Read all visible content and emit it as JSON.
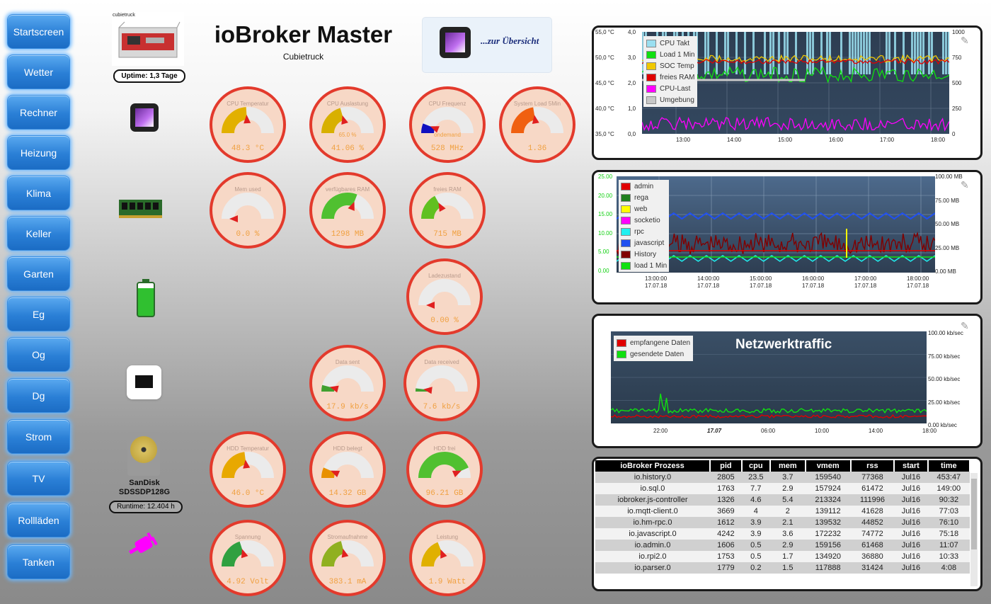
{
  "nav": [
    "Startscreen",
    "Wetter",
    "Rechner",
    "Heizung",
    "Klima",
    "Keller",
    "Garten",
    "Eg",
    "Og",
    "Dg",
    "Strom",
    "TV",
    "Rollläden",
    "Tanken"
  ],
  "header": {
    "title": "ioBroker Master",
    "subtitle": "Cubietruck",
    "overview_link": "...zur Übersicht"
  },
  "device": {
    "caption": "cubietruck",
    "uptime": "Uptime: 1,3 Tage"
  },
  "disk": {
    "name_line1": "SanDisk",
    "name_line2": "SDSSDP128G",
    "runtime": "Runtime: 12.404 h"
  },
  "gauges": [
    {
      "title": "CPU Temperatur",
      "value": "48.3 °C",
      "fill": 0.48,
      "color": "#e2b000"
    },
    {
      "title": "CPU Auslastung",
      "value": "41.06 %",
      "inner": "65.0 %",
      "fill": 0.41,
      "color": "#d8b000"
    },
    {
      "title": "CPU Frequenz",
      "value": "528 MHz",
      "inner": "ondemand",
      "fill": 0.12,
      "color": "#1010c0"
    },
    {
      "title": "System Load 5Min",
      "value": "1.36",
      "fill": 0.45,
      "color": "#f06010"
    },
    {
      "title": "Mem used",
      "value": "0.0 %",
      "fill": 0.0,
      "color": "#e0e0e0"
    },
    {
      "title": "verfügbares RAM",
      "value": "1298 MB",
      "fill": 0.62,
      "color": "#50c030"
    },
    {
      "title": "freies RAM",
      "value": "715 MB",
      "fill": 0.34,
      "color": "#60c020"
    },
    {
      "title": "Ladezustand",
      "value": "0.00 %",
      "fill": 0.0,
      "color": "#e0e0e0"
    },
    {
      "title": "Data sent",
      "value": "17.9 kb/s",
      "fill": 0.08,
      "color": "#40a030"
    },
    {
      "title": "Data received",
      "value": "7.6 kb/s",
      "fill": 0.04,
      "color": "#40a030"
    },
    {
      "title": "HDD Temperatur",
      "value": "46.0 °C",
      "fill": 0.46,
      "color": "#e8a800"
    },
    {
      "title": "HDD belegt",
      "value": "14.32 GB",
      "fill": 0.13,
      "color": "#e89000"
    },
    {
      "title": "HDD frei",
      "value": "96.21 GB",
      "fill": 0.87,
      "color": "#50c030"
    },
    {
      "title": "Spannung",
      "value": "4.92 Volt",
      "fill": 0.4,
      "color": "#30a040"
    },
    {
      "title": "Stromaufnahme",
      "value": "383.1 mA",
      "fill": 0.42,
      "color": "#90b020"
    },
    {
      "title": "Leistung",
      "value": "1.9 Watt",
      "fill": 0.38,
      "color": "#e0b000"
    }
  ],
  "chart_data": [
    {
      "type": "line",
      "title": "",
      "series": [
        {
          "name": "CPU Takt",
          "color": "#9adff0"
        },
        {
          "name": "Load 1 Min",
          "color": "#10e010"
        },
        {
          "name": "SOC Temp",
          "color": "#f0c800"
        },
        {
          "name": "freies RAM",
          "color": "#e00000"
        },
        {
          "name": "CPU-Last",
          "color": "#ff00ff"
        },
        {
          "name": "Umgebung",
          "color": "#c8c8c8"
        }
      ],
      "y_left_labels": [
        "55,0 °C",
        "50,0 °C",
        "45,0 °C",
        "40,0 °C",
        "35,0 °C"
      ],
      "y_mid_labels": [
        "4,0",
        "3,0",
        "2,0",
        "1,0",
        "0,0"
      ],
      "y_right_labels": [
        "1000",
        "750",
        "500",
        "250",
        "0"
      ],
      "x_labels": [
        "13:00",
        "14:00",
        "15:00",
        "16:00",
        "17:00",
        "18:00"
      ]
    },
    {
      "type": "line",
      "title": "",
      "series": [
        {
          "name": "admin",
          "color": "#e00000"
        },
        {
          "name": "rega",
          "color": "#208020"
        },
        {
          "name": "web",
          "color": "#ffff00"
        },
        {
          "name": "socketio",
          "color": "#ff00ff"
        },
        {
          "name": "rpc",
          "color": "#20f0f0"
        },
        {
          "name": "javascript",
          "color": "#2050f0"
        },
        {
          "name": "History",
          "color": "#800000"
        },
        {
          "name": "load 1 Min",
          "color": "#10e010"
        }
      ],
      "y_left_labels": [
        "25.00",
        "20.00",
        "15.00",
        "10.00",
        "5.00",
        "0.00"
      ],
      "y_right_labels": [
        "100.00 MB",
        "75.00 MB",
        "50.00 MB",
        "25.00 MB",
        "0.00 MB"
      ],
      "x_labels": [
        [
          "13:00:00",
          "17.07.18"
        ],
        [
          "14:00:00",
          "17.07.18"
        ],
        [
          "15:00:00",
          "17.07.18"
        ],
        [
          "16:00:00",
          "17.07.18"
        ],
        [
          "17:00:00",
          "17.07.18"
        ],
        [
          "18:00:00",
          "17.07.18"
        ]
      ]
    },
    {
      "type": "line",
      "title": "Netzwerktraffic",
      "series": [
        {
          "name": "empfangene Daten",
          "color": "#e00000"
        },
        {
          "name": "gesendete Daten",
          "color": "#10e010"
        }
      ],
      "y_right_labels": [
        "100.00 kb/sec",
        "75.00 kb/sec",
        "50.00 kb/sec",
        "25.00 kb/sec",
        "0.00 kb/sec"
      ],
      "x_labels": [
        "22:00",
        "17.07",
        "06:00",
        "10:00",
        "14:00",
        "18:00"
      ]
    }
  ],
  "process_table": {
    "headers": [
      "ioBroker Prozess",
      "pid",
      "cpu",
      "mem",
      "vmem",
      "rss",
      "start",
      "time"
    ],
    "rows": [
      [
        "io.history.0",
        "2805",
        "23.5",
        "3.7",
        "159540",
        "77368",
        "Jul16",
        "453:47"
      ],
      [
        "io.sql.0",
        "1763",
        "7.7",
        "2.9",
        "157924",
        "61472",
        "Jul16",
        "149:00"
      ],
      [
        "iobroker.js-controller",
        "1326",
        "4.6",
        "5.4",
        "213324",
        "111996",
        "Jul16",
        "90:32"
      ],
      [
        "io.mqtt-client.0",
        "3669",
        "4",
        "2",
        "139112",
        "41628",
        "Jul16",
        "77:03"
      ],
      [
        "io.hm-rpc.0",
        "1612",
        "3.9",
        "2.1",
        "139532",
        "44852",
        "Jul16",
        "76:10"
      ],
      [
        "io.javascript.0",
        "4242",
        "3.9",
        "3.6",
        "172232",
        "74772",
        "Jul16",
        "75:18"
      ],
      [
        "io.admin.0",
        "1606",
        "0.5",
        "2.9",
        "159156",
        "61468",
        "Jul16",
        "11:07"
      ],
      [
        "io.rpi2.0",
        "1753",
        "0.5",
        "1.7",
        "134920",
        "36880",
        "Jul16",
        "10:33"
      ],
      [
        "io.parser.0",
        "1779",
        "0.2",
        "1.5",
        "117888",
        "31424",
        "Jul16",
        "4:08"
      ]
    ]
  }
}
